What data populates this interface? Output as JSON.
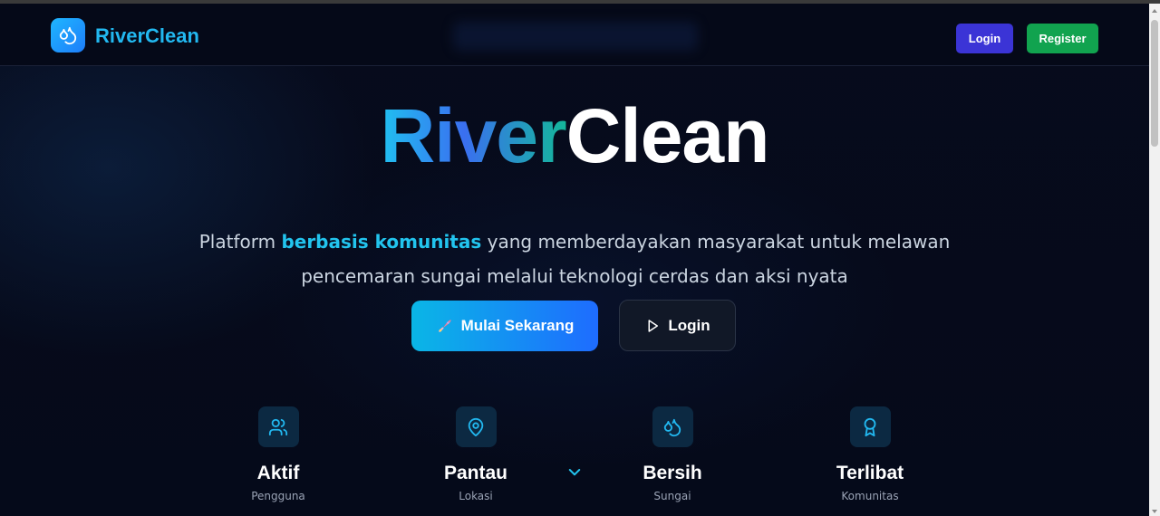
{
  "brand": {
    "name": "RiverClean",
    "logo_icon": "droplets-icon",
    "accent": "#22b8f0"
  },
  "nav": {
    "login_label": "Login",
    "register_label": "Register"
  },
  "hero": {
    "title_part1": "River",
    "title_part2": "Clean",
    "desc_before": "Platform ",
    "desc_highlight": "berbasis komunitas",
    "desc_after": " yang memberdayakan masyarakat untuk melawan pencemaran sungai melalui teknologi cerdas dan aksi nyata",
    "cta_primary": "Mulai Sekarang",
    "cta_primary_icon": "rocket-icon",
    "cta_secondary": "Login",
    "cta_secondary_icon": "play-icon"
  },
  "stats": [
    {
      "title": "Aktif",
      "subtitle": "Pengguna",
      "icon": "users-icon"
    },
    {
      "title": "Pantau",
      "subtitle": "Lokasi",
      "icon": "map-pin-icon"
    },
    {
      "title": "Bersih",
      "subtitle": "Sungai",
      "icon": "droplets-icon"
    },
    {
      "title": "Terlibat",
      "subtitle": "Komunitas",
      "icon": "award-icon"
    }
  ],
  "scroll_indicator_icon": "chevron-down-icon"
}
